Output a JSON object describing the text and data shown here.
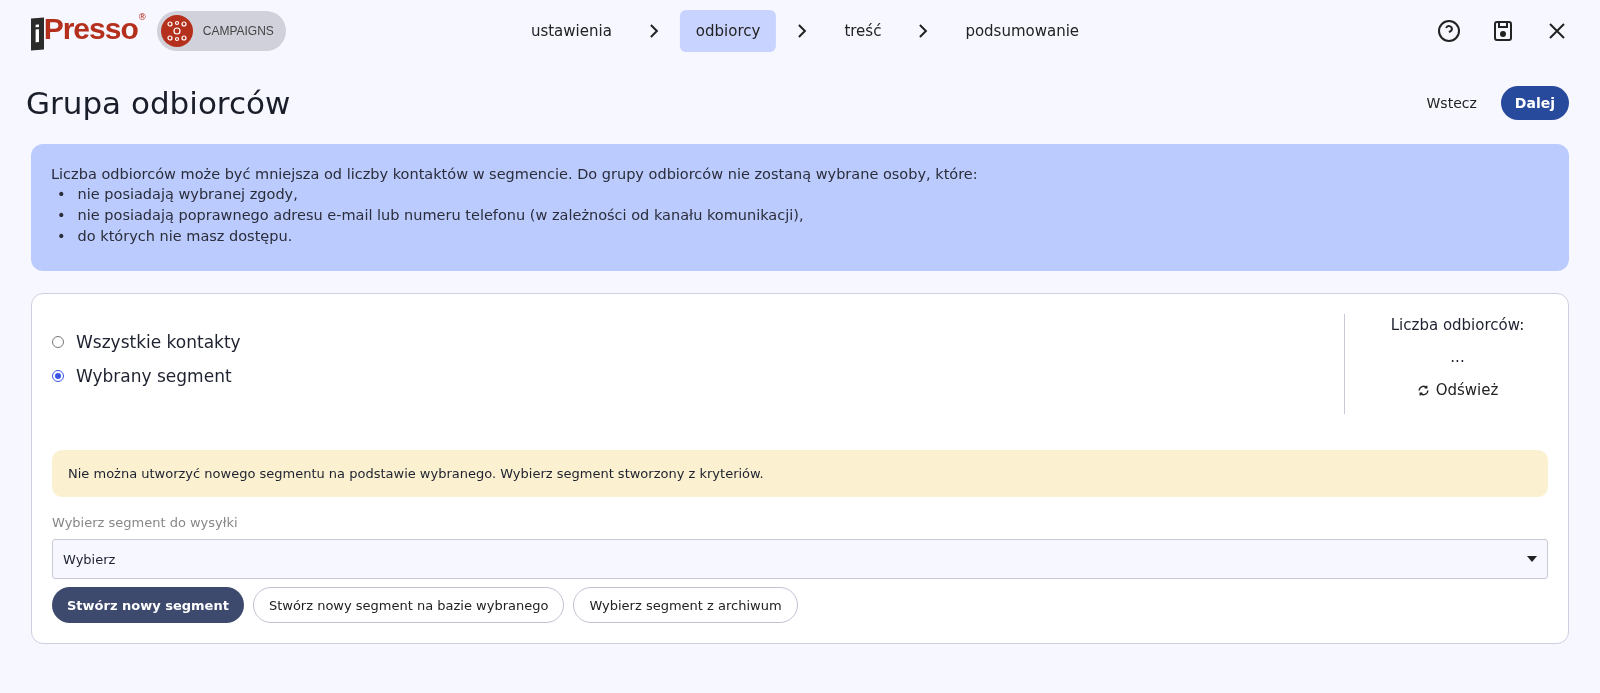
{
  "header": {
    "logo": {
      "mark": "i",
      "name": "Presso",
      "reg": "®"
    },
    "module": "CAMPAIGNS",
    "steps": [
      {
        "label": "ustawienia",
        "selected": false
      },
      {
        "label": "odbiorcy",
        "selected": true
      },
      {
        "label": "treść",
        "selected": false
      },
      {
        "label": "podsumowanie",
        "selected": false
      }
    ]
  },
  "page": {
    "title": "Grupa odbiorców",
    "back": "Wstecz",
    "next": "Dalej"
  },
  "info": {
    "bullet": "•",
    "intro": "Liczba odbiorców może być mniejsza od liczby kontaktów w segmencie. Do grupy odbiorców nie zostaną wybrane osoby, które:",
    "items": [
      "nie posiadają wybranej zgody,",
      "nie posiadają poprawnego adresu e-mail lub numeru telefonu (w zależności od kanału komunikacji),",
      "do których nie masz dostępu."
    ]
  },
  "options": [
    {
      "label": "Wszystkie kontakty",
      "selected": false
    },
    {
      "label": "Wybrany segment",
      "selected": true
    }
  ],
  "count": {
    "label": "Liczba odbiorców:",
    "value": "...",
    "refresh": "Odśwież"
  },
  "warning": "Nie można utworzyć nowego segmentu na podstawie wybranego. Wybierz segment stworzony z kryteriów.",
  "segment_select": {
    "label": "Wybierz segment do wysyłki",
    "value": "Wybierz"
  },
  "actions": [
    {
      "label": "Stwórz nowy segment",
      "kind": "primary"
    },
    {
      "label": "Stwórz nowy segment na bazie wybranego",
      "kind": "outline"
    },
    {
      "label": "Wybierz segment z archiwum",
      "kind": "outline"
    }
  ]
}
